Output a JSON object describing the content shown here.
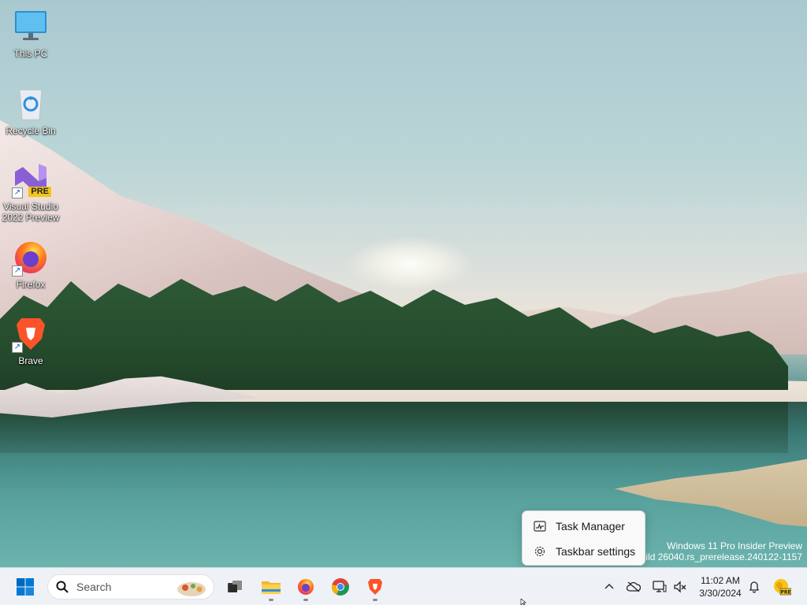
{
  "desktop": {
    "icons": [
      {
        "label": "This PC",
        "icon": "monitor-icon"
      },
      {
        "label": "Recycle Bin",
        "icon": "recycle-bin-icon"
      },
      {
        "label": "Visual Studio 2022 Preview",
        "icon": "visual-studio-preview-icon",
        "badge": "PRE"
      },
      {
        "label": "Firefox",
        "icon": "firefox-icon"
      },
      {
        "label": "Brave",
        "icon": "brave-icon"
      }
    ]
  },
  "watermark": {
    "line1": "Windows 11 Pro Insider Preview",
    "line2": "Build 26040.rs_prerelease.240122-1157"
  },
  "context_menu": {
    "items": [
      {
        "label": "Task Manager",
        "icon": "task-manager-icon"
      },
      {
        "label": "Taskbar settings",
        "icon": "gear-icon"
      }
    ]
  },
  "taskbar": {
    "search": {
      "placeholder": "Search"
    },
    "pinned": [
      {
        "name": "task-view",
        "icon": "task-view-icon",
        "running": false
      },
      {
        "name": "file-explorer",
        "icon": "folder-icon",
        "running": true
      },
      {
        "name": "firefox",
        "icon": "firefox-icon",
        "running": true
      },
      {
        "name": "chrome",
        "icon": "chrome-icon",
        "running": false
      },
      {
        "name": "brave",
        "icon": "brave-icon",
        "running": true
      }
    ],
    "tray": {
      "time": "11:02 AM",
      "date": "3/30/2024",
      "icons": [
        "chevron-up-icon",
        "onedrive-offline-icon",
        "network-icon",
        "volume-muted-icon",
        "notification-bell-icon",
        "dev-home-preview-icon"
      ]
    }
  },
  "colors": {
    "taskbar_bg": "#eef1f6",
    "menu_bg": "#f9f9f9",
    "windows_blue": "#0067c0"
  }
}
